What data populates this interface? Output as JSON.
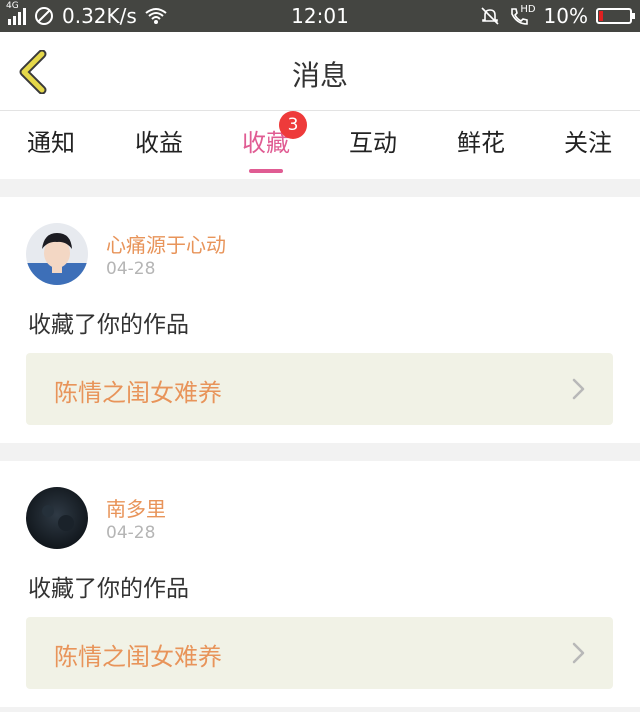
{
  "status_bar": {
    "network_type": "4G",
    "speed": "0.32K/s",
    "time": "12:01",
    "hd_label": "HD",
    "battery": "10%",
    "icons": [
      "signal-icon",
      "blocked-icon",
      "wifi-icon",
      "mute-bell-icon",
      "call-hd-icon",
      "battery-icon"
    ]
  },
  "header": {
    "title": "消息",
    "back_icon": "chevron-left-icon"
  },
  "tabs": [
    {
      "label": "通知"
    },
    {
      "label": "收益"
    },
    {
      "label": "收藏",
      "badge": "3",
      "active": true
    },
    {
      "label": "互动"
    },
    {
      "label": "鲜花"
    },
    {
      "label": "关注"
    }
  ],
  "notifications": [
    {
      "user": "心痛源于心动",
      "date": "04-28",
      "action": "收藏了你的作品",
      "work_title": "陈情之闺女难养"
    },
    {
      "user": "南多里",
      "date": "04-28",
      "action": "收藏了你的作品",
      "work_title": "陈情之闺女难养"
    }
  ],
  "colors": {
    "accent": "#e05c93",
    "badge": "#ee3a3a",
    "username": "#e8945a",
    "back_arrow": "#e5d84a",
    "work_bg": "#f1f2e6"
  }
}
